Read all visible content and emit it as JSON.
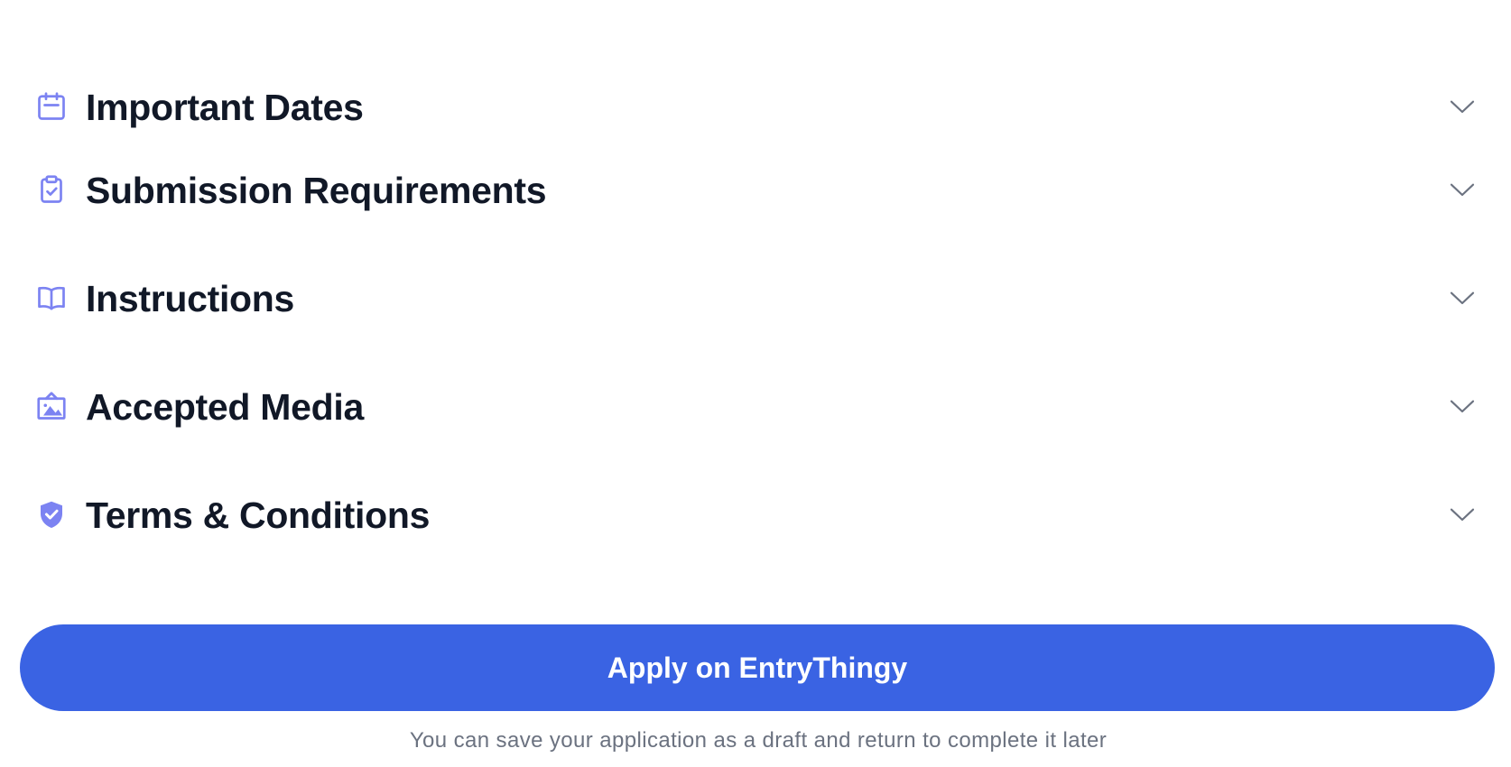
{
  "accordion": {
    "items": [
      {
        "label": "Important Dates",
        "icon": "calendar-icon",
        "expanded": false
      },
      {
        "label": "Submission Requirements",
        "icon": "clipboard-check-icon",
        "expanded": false
      },
      {
        "label": "Instructions",
        "icon": "book-open-icon",
        "expanded": false
      },
      {
        "label": "Accepted Media",
        "icon": "image-icon",
        "expanded": false
      },
      {
        "label": "Terms & Conditions",
        "icon": "shield-check-icon",
        "expanded": false
      }
    ]
  },
  "apply": {
    "label": "Apply on EntryThingy",
    "helper": "You can save your application as a draft and return to complete it later"
  },
  "colors": {
    "icon": "#7c83f2",
    "title": "#111827",
    "chevron": "#6b7280",
    "button": "#3a63e3",
    "button_text": "#ffffff",
    "helper": "#6b7280"
  }
}
